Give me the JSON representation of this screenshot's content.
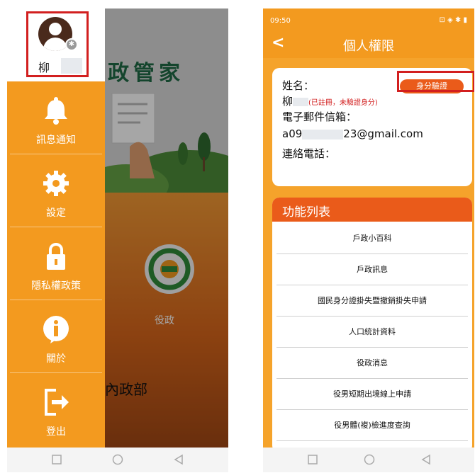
{
  "left_screen": {
    "background": {
      "title": "政管家",
      "service_label": "役政",
      "ministry_logo": "內政部"
    },
    "drawer": {
      "user_name": "柳",
      "menu": [
        {
          "label": "訊息通知",
          "icon": "bell-icon"
        },
        {
          "label": "設定",
          "icon": "gear-icon"
        },
        {
          "label": "隱私權政策",
          "icon": "lock-icon"
        },
        {
          "label": "關於",
          "icon": "info-icon"
        },
        {
          "label": "登出",
          "icon": "logout-icon"
        }
      ]
    }
  },
  "right_screen": {
    "status": {
      "time": "09:50",
      "right": "⊡ ◈ ✱ ▮"
    },
    "title": "個人權限",
    "profile": {
      "name_label": "姓名：",
      "verify_button": "身分驗證",
      "name_value": "柳",
      "name_note": "(已註冊，未驗證身分)",
      "email_label": "電子郵件信箱：",
      "email_prefix": "a09",
      "email_suffix": "23@gmail.com",
      "phone_label": "連絡電話："
    },
    "functions": {
      "title": "功能列表",
      "items": [
        "戶政小百科",
        "戶政訊息",
        "國民身分證掛失暨撤銷掛失申請",
        "人口統計資料",
        "役政消息",
        "役男短期出境線上申請",
        "役男體(複)檢進度查詢"
      ]
    }
  },
  "colors": {
    "orange": "#f39a1f",
    "deep_orange": "#ea5b1a",
    "highlight_red": "#d21f1f",
    "avatar_brown": "#4a2a1c"
  }
}
